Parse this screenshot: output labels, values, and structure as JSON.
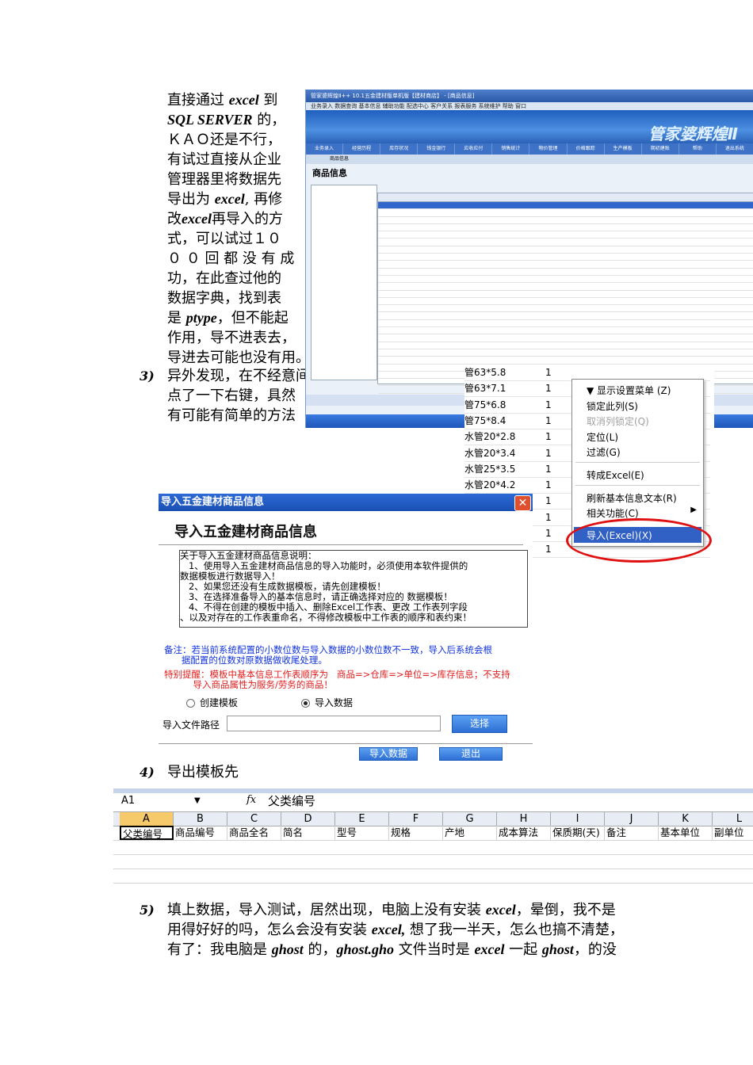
{
  "para_top": {
    "lines": [
      [
        "直接通过 ",
        "excel",
        " 到"
      ],
      [
        "SQL SERVER",
        " 的，"
      ],
      [
        "ＫＡＯ还是不行，"
      ],
      [
        "有试过直接从企业"
      ],
      [
        "管理器里将数据先"
      ],
      [
        "导出为 ",
        "excel",
        ", 再修"
      ],
      [
        "改",
        "excel",
        "再导入的方"
      ],
      [
        "式，可以试过１０"
      ],
      [
        "０ ０ 回 都 没 有 成"
      ],
      [
        "功，在此查过他的"
      ],
      [
        "数据字典，找到表"
      ],
      [
        "是 ",
        "ptype",
        "，但不能起"
      ],
      [
        "作用，导不进表去，"
      ],
      [
        "导进去可能也没有用。"
      ]
    ]
  },
  "step3": {
    "num": "3)",
    "lines": [
      "异外发现，在不经意间",
      "点了一下右键，具然",
      "有可能有简单的方法"
    ]
  },
  "app": {
    "title": "管家婆辉煌Ⅱ++ 10.1五金建材版单机版【建材商店】 - [商品信息]",
    "menu": "业务录入  数据查询  基本信息  辅助功能  配选中心  客户关系  报表服务  系统维护  帮助  窗口",
    "brand": "管家婆辉煌Ⅱ",
    "nav": [
      "业务录入",
      "经营历程",
      "库存状况",
      "钱金银行",
      "应收应付",
      "销售统计",
      "物价管理",
      "价格跟踪",
      "生产模板",
      "期初建账",
      "帮助",
      "退出系统"
    ],
    "subtitle": "商品信息",
    "tab": "商品信息"
  },
  "cells": [
    {
      "name": "管63*5.8",
      "v": "1"
    },
    {
      "name": "管63*7.1",
      "v": "1"
    },
    {
      "name": "管75*6.8",
      "v": "1"
    },
    {
      "name": "管75*8.4",
      "v": "1"
    },
    {
      "name": "水管20*2.8",
      "v": "1"
    },
    {
      "name": "水管20*3.4",
      "v": "1"
    },
    {
      "name": "水管25*3.5",
      "v": "1"
    },
    {
      "name": "水管20*4.2",
      "v": "1"
    },
    {
      "name": "",
      "v": "1"
    },
    {
      "name": "",
      "v": "1"
    },
    {
      "name": "",
      "v": "1"
    },
    {
      "name": "",
      "v": "1"
    }
  ],
  "context_menu": {
    "show_settings": "▼ 显示设置菜单 (Z)",
    "lock_col": "锁定此列(S)",
    "unlock_col": "取消列锁定(Q)",
    "locate": "定位(L)",
    "filter": "过滤(G)",
    "to_excel": "转成Excel(E)",
    "refresh": "刷新基本信息文本(R)",
    "related": "相关功能(C)",
    "import": "导入(Excel)(X)"
  },
  "dialog": {
    "title": "导入五金建材商品信息",
    "heading": "导入五金建材商品信息",
    "notes": [
      "关于导入五金建材商品信息说明：",
      "   1、使用导入五金建材商品信息的导入功能时，必须使用本软件提供的",
      "数据模板进行数据导入！",
      "   2、如果您还没有生成数据模板，请先创建模板！",
      "   3、在选择准备导入的基本信息时，请正确选择对应的 数据模板！",
      "   4、不得在创建的模板中插入、删除Excel工作表、更改 工作表列字段",
      "、以及对存在的工作表重命名，不得修改模板中工作表的顺序和表约束！"
    ],
    "blue_note": [
      "备注：若当前系统配置的小数位数与导入数据的小数位数不一致，导入后系统会根",
      "      据配置的位数对原数据做收尾处理。"
    ],
    "red_note": [
      "特别提醒：模板中基本信息工作表顺序为   商品=>仓库=>单位=>库存信息；不支持",
      "          导入商品属性为服务/劳务的商品！"
    ],
    "radio_create": "创建模板",
    "radio_import": "导入数据",
    "path_label": "导入文件路径",
    "btn_select": "选择",
    "btn_import": "导入数据",
    "btn_exit": "退出"
  },
  "step4": {
    "num": "4)",
    "text": "导出模板先"
  },
  "excel": {
    "cell_ref": "A1",
    "fx": "fx",
    "formula_value": "父类编号",
    "columns": [
      "A",
      "B",
      "C",
      "D",
      "E",
      "F",
      "G",
      "H",
      "I",
      "J",
      "K",
      "L"
    ],
    "headers": [
      "父类编号",
      "商品编号",
      "商品全名",
      "简名",
      "型号",
      "规格",
      "产地",
      "成本算法",
      "保质期(天)",
      "备注",
      "基本单位",
      "副单位"
    ]
  },
  "step5": {
    "num": "5)",
    "lines": [
      [
        "填上数据，导入测试，居然出现，电脑上没有安装 ",
        "excel",
        "，晕倒，我不是"
      ],
      [
        "用得好好的吗，怎么会没有安装 ",
        "excel,",
        " 想了我一半天，怎么也搞不清楚，"
      ],
      [
        "有了：我电脑是 ",
        "ghost",
        " 的，",
        "ghost.gho",
        " 文件当时是 ",
        "excel",
        " 一起 ",
        "ghost",
        "，的没"
      ]
    ]
  }
}
